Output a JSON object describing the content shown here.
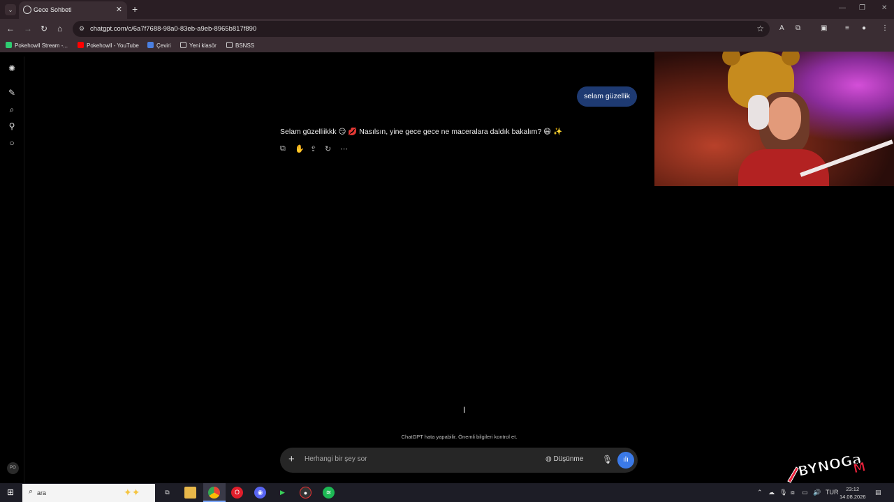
{
  "browser": {
    "tab_title": "Gece Sohbeti",
    "url": "chatgpt.com/c/6a7f7688-98a0-83eb-a9eb-8965b817f890",
    "bookmarks": [
      {
        "label": "Pokehowll Stream -...",
        "color": "#2ecc71"
      },
      {
        "label": "Pokehowll - YouTube",
        "color": "#ff0000"
      },
      {
        "label": "Çeviri",
        "color": "#4a7fe0"
      },
      {
        "label": "Yeni klasör",
        "color": "#cccccc"
      },
      {
        "label": "BSNSS",
        "color": "#cccccc"
      }
    ]
  },
  "chat": {
    "user_message": "selam güzellik",
    "assistant_message": "Selam güzelliikkk 😏 💋 Nasılsın, yine gece gece ne maceralara daldık bakalım? 😄 ✨",
    "disclaimer": "ChatGPT hata yapabilir. Önemli bilgileri kontrol et.",
    "composer_placeholder": "Herhangi bir şey sor",
    "thinking_label": "Düşünme"
  },
  "sidebar": {
    "avatar_initials": "PO"
  },
  "watermark": {
    "text": "BYNOGaM"
  },
  "taskbar": {
    "search_text": "ara",
    "language": "TUR",
    "time": "23:12",
    "date": "14.08.2026"
  },
  "colors": {
    "user_bubble": "#1e3a72",
    "voice_button": "#3b7ae8",
    "browser_frame": "#3a2d33"
  }
}
